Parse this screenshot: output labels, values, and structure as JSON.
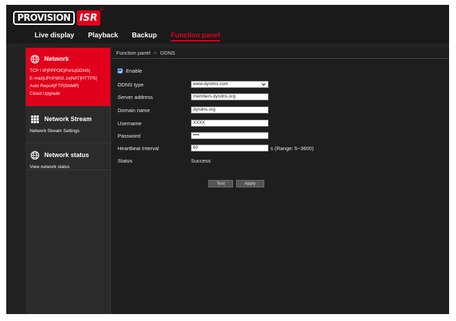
{
  "brand": {
    "logo_left": "PROVISION",
    "logo_right": "ISR",
    "registered": "®"
  },
  "topnav": [
    {
      "label": "Live display",
      "active": false
    },
    {
      "label": "Playback",
      "active": false
    },
    {
      "label": "Backup",
      "active": false
    },
    {
      "label": "Function panel",
      "active": true
    }
  ],
  "sidebar": {
    "network": {
      "title": "Network",
      "links": [
        "TCP / IP|PPPOE|Ports|DDNS|",
        "E-mail|UPnP|802.1x|NAT|HTTPS|",
        "Auto Report|FTP|SNMP|",
        "Cloud Upgrade"
      ]
    },
    "stream": {
      "title": "Network Stream",
      "links": [
        "Network Stream Settings"
      ]
    },
    "status": {
      "title": "Network status",
      "links": [
        "View network status"
      ]
    }
  },
  "breadcrumb": {
    "parent": "Function panel",
    "separator": ">",
    "current": "DDNS"
  },
  "form": {
    "enable_label": "Enable",
    "ddns_type": {
      "label": "DDNS type",
      "value": "www.dyndns.com"
    },
    "server_address": {
      "label": "Server address",
      "value": "members.dyndns.org"
    },
    "domain_name": {
      "label": "Domain name",
      "value": "dyndns.org"
    },
    "username": {
      "label": "Username",
      "value": "XXXX"
    },
    "password": {
      "label": "Password",
      "value": "••••"
    },
    "heartbeat": {
      "label": "Heartbeat Interval",
      "value": "60",
      "note": "s (Range:  5~3600)"
    },
    "status": {
      "label": "Status",
      "value": "Success"
    }
  },
  "buttons": {
    "test": "Test",
    "apply": "Apply"
  },
  "colors": {
    "accent": "#e0001b",
    "panel": "#1e1e1e",
    "sidebar": "#2b2b2b"
  }
}
